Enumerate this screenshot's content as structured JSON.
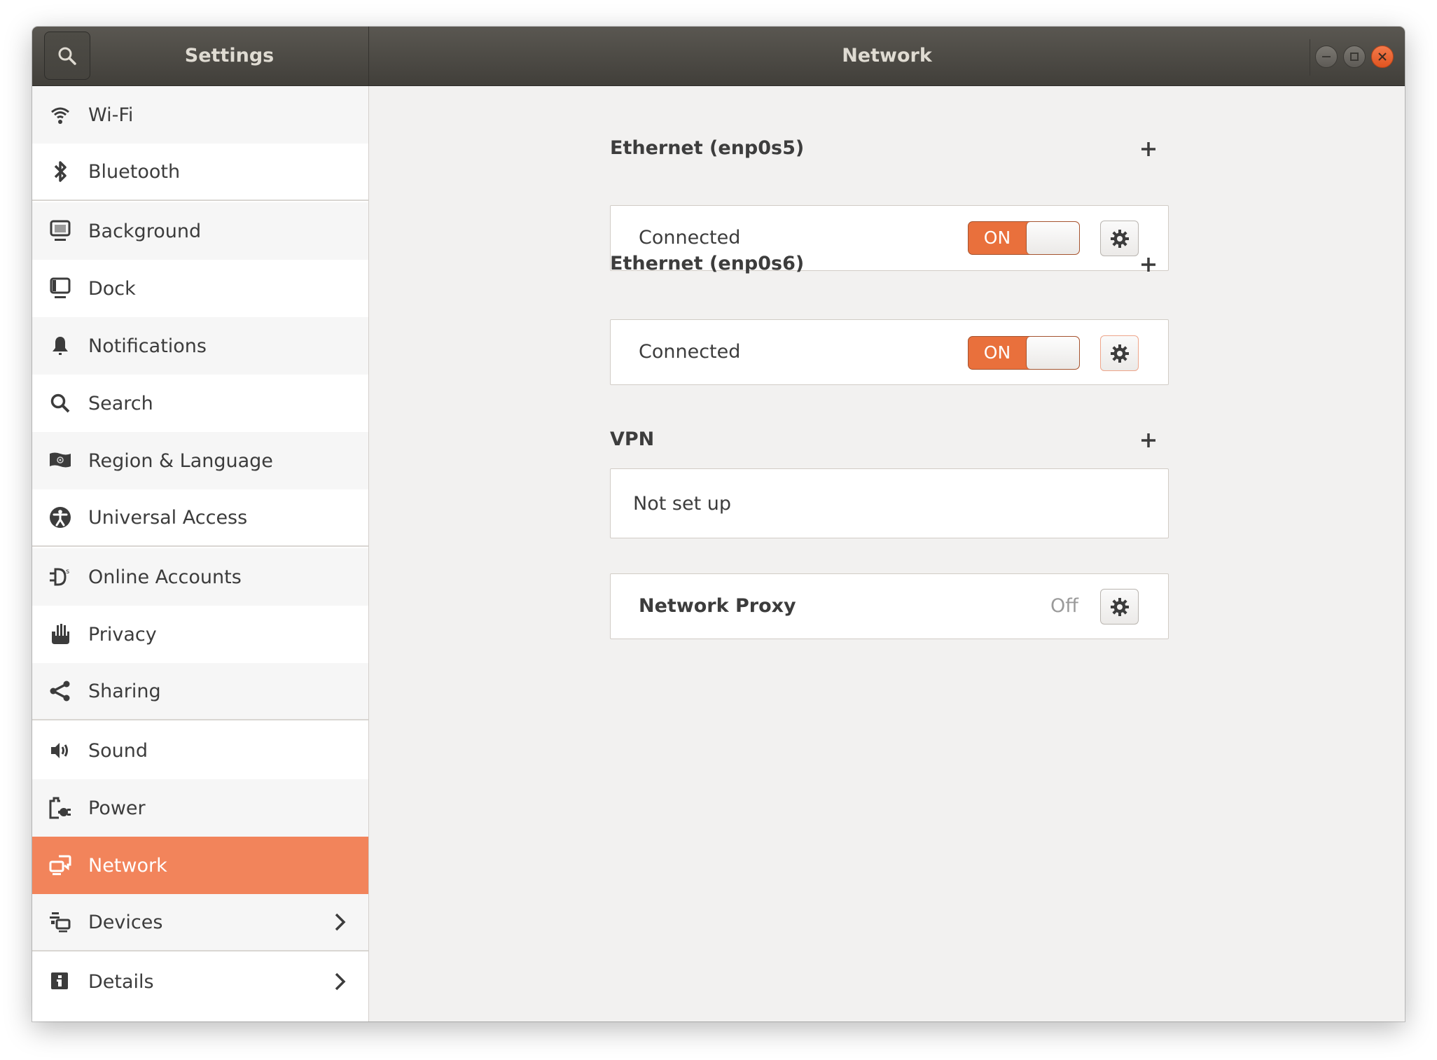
{
  "window": {
    "sidebar_title": "Settings",
    "panel_title": "Network",
    "controls": [
      "minimize",
      "maximize",
      "close"
    ]
  },
  "sidebar": {
    "items": [
      {
        "label": "Wi-Fi",
        "icon": "wifi-icon"
      },
      {
        "label": "Bluetooth",
        "icon": "bluetooth-icon"
      },
      {
        "label": "Background",
        "icon": "background-icon"
      },
      {
        "label": "Dock",
        "icon": "dock-icon"
      },
      {
        "label": "Notifications",
        "icon": "bell-icon"
      },
      {
        "label": "Search",
        "icon": "search-icon"
      },
      {
        "label": "Region & Language",
        "icon": "region-flag-icon"
      },
      {
        "label": "Universal Access",
        "icon": "accessibility-icon"
      },
      {
        "label": "Online Accounts",
        "icon": "online-accounts-icon"
      },
      {
        "label": "Privacy",
        "icon": "hand-icon"
      },
      {
        "label": "Sharing",
        "icon": "share-icon"
      },
      {
        "label": "Sound",
        "icon": "speaker-icon"
      },
      {
        "label": "Power",
        "icon": "power-plug-icon"
      },
      {
        "label": "Network",
        "icon": "network-icon",
        "active": true
      },
      {
        "label": "Devices",
        "icon": "devices-icon",
        "has_submenu": true
      },
      {
        "label": "Details",
        "icon": "info-icon",
        "has_submenu": true
      }
    ]
  },
  "network": {
    "ethernet": [
      {
        "title": "Ethernet (enp0s5)",
        "status": "Connected",
        "switch_label": "ON",
        "enabled": true
      },
      {
        "title": "Ethernet (enp0s6)",
        "status": "Connected",
        "switch_label": "ON",
        "enabled": true
      }
    ],
    "vpn": {
      "title": "VPN",
      "status": "Not set up"
    },
    "proxy": {
      "title": "Network Proxy",
      "status": "Off"
    }
  },
  "colors": {
    "accent": "#e9703c",
    "sidebar_active": "#f2845b",
    "close_button": "#e95420",
    "titlebar": "#4a4843"
  }
}
